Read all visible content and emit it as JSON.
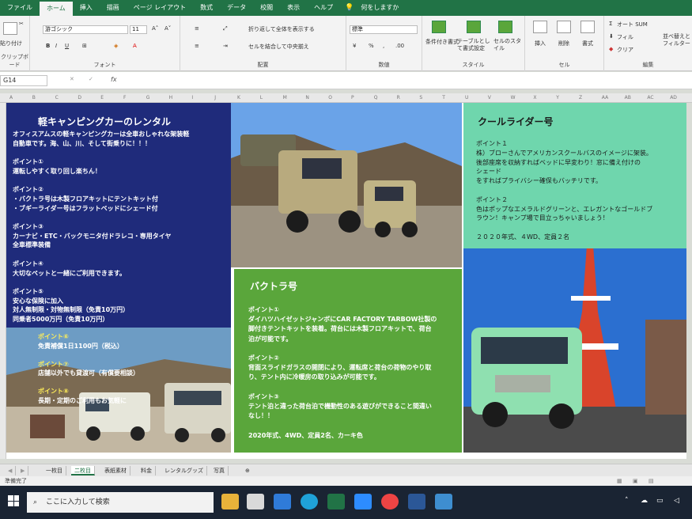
{
  "ribbon_tabs": [
    "ファイル",
    "ホーム",
    "挿入",
    "描画",
    "ページ レイアウト",
    "数式",
    "データ",
    "校閲",
    "表示",
    "ヘルプ",
    "何をしますか"
  ],
  "ribbon": {
    "paste_label": "貼り付け",
    "clipboard_label": "クリップボード",
    "font_name": "游ゴシック",
    "font_size": "11",
    "font_group": "フォント",
    "wrap_text": "折り返して全体を表示する",
    "merge_center": "セルを結合して中央揃え",
    "align_group": "配置",
    "number_format": "標準",
    "number_group": "数値",
    "conditional": "条件付き書式",
    "table_format": "テーブルとして書式設定",
    "cell_style": "セルのスタイル",
    "style_group": "スタイル",
    "insert": "挿入",
    "delete": "削除",
    "format": "書式",
    "cell_group": "セル",
    "autosum": "オート SUM",
    "fill": "フィル",
    "clear": "クリア",
    "sort_filter": "並べ替えとフィルター",
    "edit_group": "編集"
  },
  "formula_bar": {
    "name_box": "G14",
    "fx": "fx"
  },
  "columns": [
    "A",
    "B",
    "C",
    "D",
    "E",
    "F",
    "G",
    "H",
    "I",
    "J",
    "K",
    "L",
    "M",
    "N",
    "O",
    "P",
    "Q",
    "R",
    "S",
    "T",
    "U",
    "V",
    "W",
    "X",
    "Y",
    "Z",
    "AA",
    "AB",
    "AC",
    "AD"
  ],
  "panel_left": {
    "title": "軽キャンピングカーのレンタル",
    "lines": [
      "オフィスアムスの軽キャンピングカーは全車おしゃれな架装軽",
      "自動車です。海、山、川、そして街乗りに！！！",
      "",
      "ポイント①",
      "運転しやすく取り回し楽ちん！",
      "",
      "ポイント②",
      "・バクトラ号は木製フロアキットにテントキット付",
      "・ブギーライダー号はフラットベッドにシェード付",
      "",
      "ポイント③",
      "カーナビ・ETC・バックモニタ付ドラレコ・専用タイヤ",
      "全車標準装備",
      "",
      "ポイント④",
      "大切なペットと一緒にご利用できます。",
      "",
      "ポイント⑤",
      "安心な保険に加入",
      "対人無制限・対物無制限（免責10万円）",
      "同乗者5000万円（免責10万円）"
    ],
    "photo_lines": [
      "ポイント⑥",
      "免責補償1日1100円（税込）",
      "",
      "ポイント⑦",
      "店舗以外でも貸渡可（有償要相談）",
      "",
      "ポイント⑧",
      "長期・定期のご利用もお気軽に"
    ]
  },
  "panel_mid": {
    "title": "バクトラ号",
    "lines": [
      "ポイント①",
      "ダイハツハイゼットジャンボにCAR FACTORY TARBOW社製の",
      "脚付きテントキットを装着。荷台には木製フロアキットで、荷台",
      "泊が可能です。",
      "",
      "ポイント②",
      "背面スライドガラスの開閉により、運転席と荷台の荷物のやり取",
      "り、テント内に冷暖房の取り込みが可能です。",
      "",
      "ポイント③",
      "テント泊と違った荷台泊で機動性のある遊びができること間違い",
      "なし！！",
      "",
      "2020年式、4WD、定員2名、カーキ色"
    ]
  },
  "panel_right": {
    "title": "クールライダー号",
    "lines": [
      "ポイント１",
      "株）ブローさんでアメリカンスクールバスのイメージに架装。",
      "後部座席を収納すればベッドに早変わり！窓に備え付けの",
      "シェード",
      "をすればプライバシー確保もバッチリです。",
      "",
      "ポイント２",
      "色はポップなエメラルドグリーンと、エレガントなゴールドブ",
      "ラウン！キャンプ場で目立っちゃいましょう！",
      "",
      "２０２０年式、４WD、定員２名"
    ]
  },
  "sheet_tabs": [
    "一枚目",
    "二枚目",
    "表紙素材",
    "料金",
    "レンタルグッズ",
    "写真"
  ],
  "active_sheet": 1,
  "status_text": "準備完了",
  "taskbar": {
    "search_placeholder": "ここに入力して検索"
  },
  "colors": {
    "excel_green": "#217346",
    "navy": "#1f2b7b",
    "green": "#5aa63b",
    "mint": "#6fd6ad"
  }
}
